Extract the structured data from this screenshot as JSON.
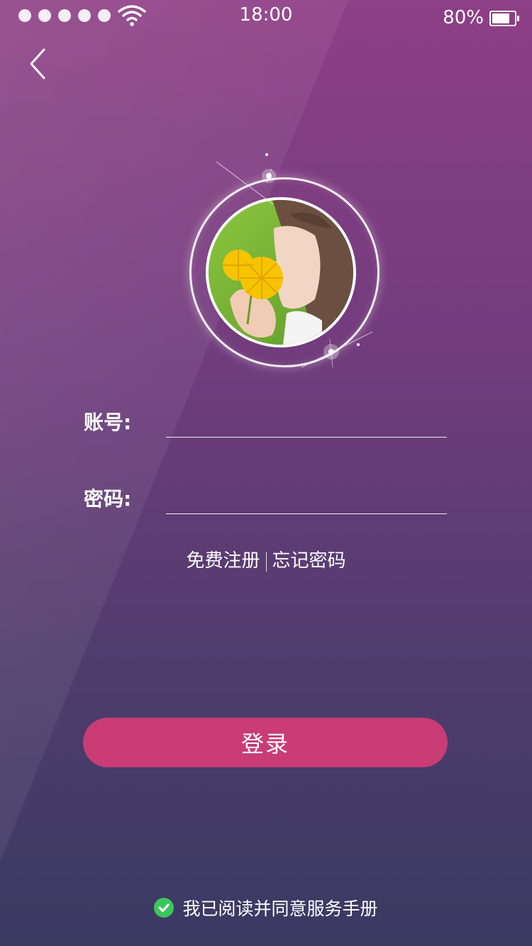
{
  "status_bar": {
    "time": "18:00",
    "battery_percent": "80%",
    "battery_level": 0.8,
    "signal_dots": 5,
    "wifi_icon": "wifi-icon"
  },
  "nav": {
    "back_icon": "chevron-left-icon"
  },
  "form": {
    "account_label": "账号:",
    "account_value": "",
    "password_label": "密码:",
    "password_value": ""
  },
  "links": {
    "register": "免费注册",
    "forgot": "忘记密码"
  },
  "login_button": "登录",
  "agreement": {
    "text": "我已阅读并同意服务手册",
    "checked": true
  },
  "colors": {
    "accent": "#c93c76",
    "check": "#3cc55d",
    "bg_top": "#8e3f86",
    "bg_bottom": "#3a3a63"
  }
}
